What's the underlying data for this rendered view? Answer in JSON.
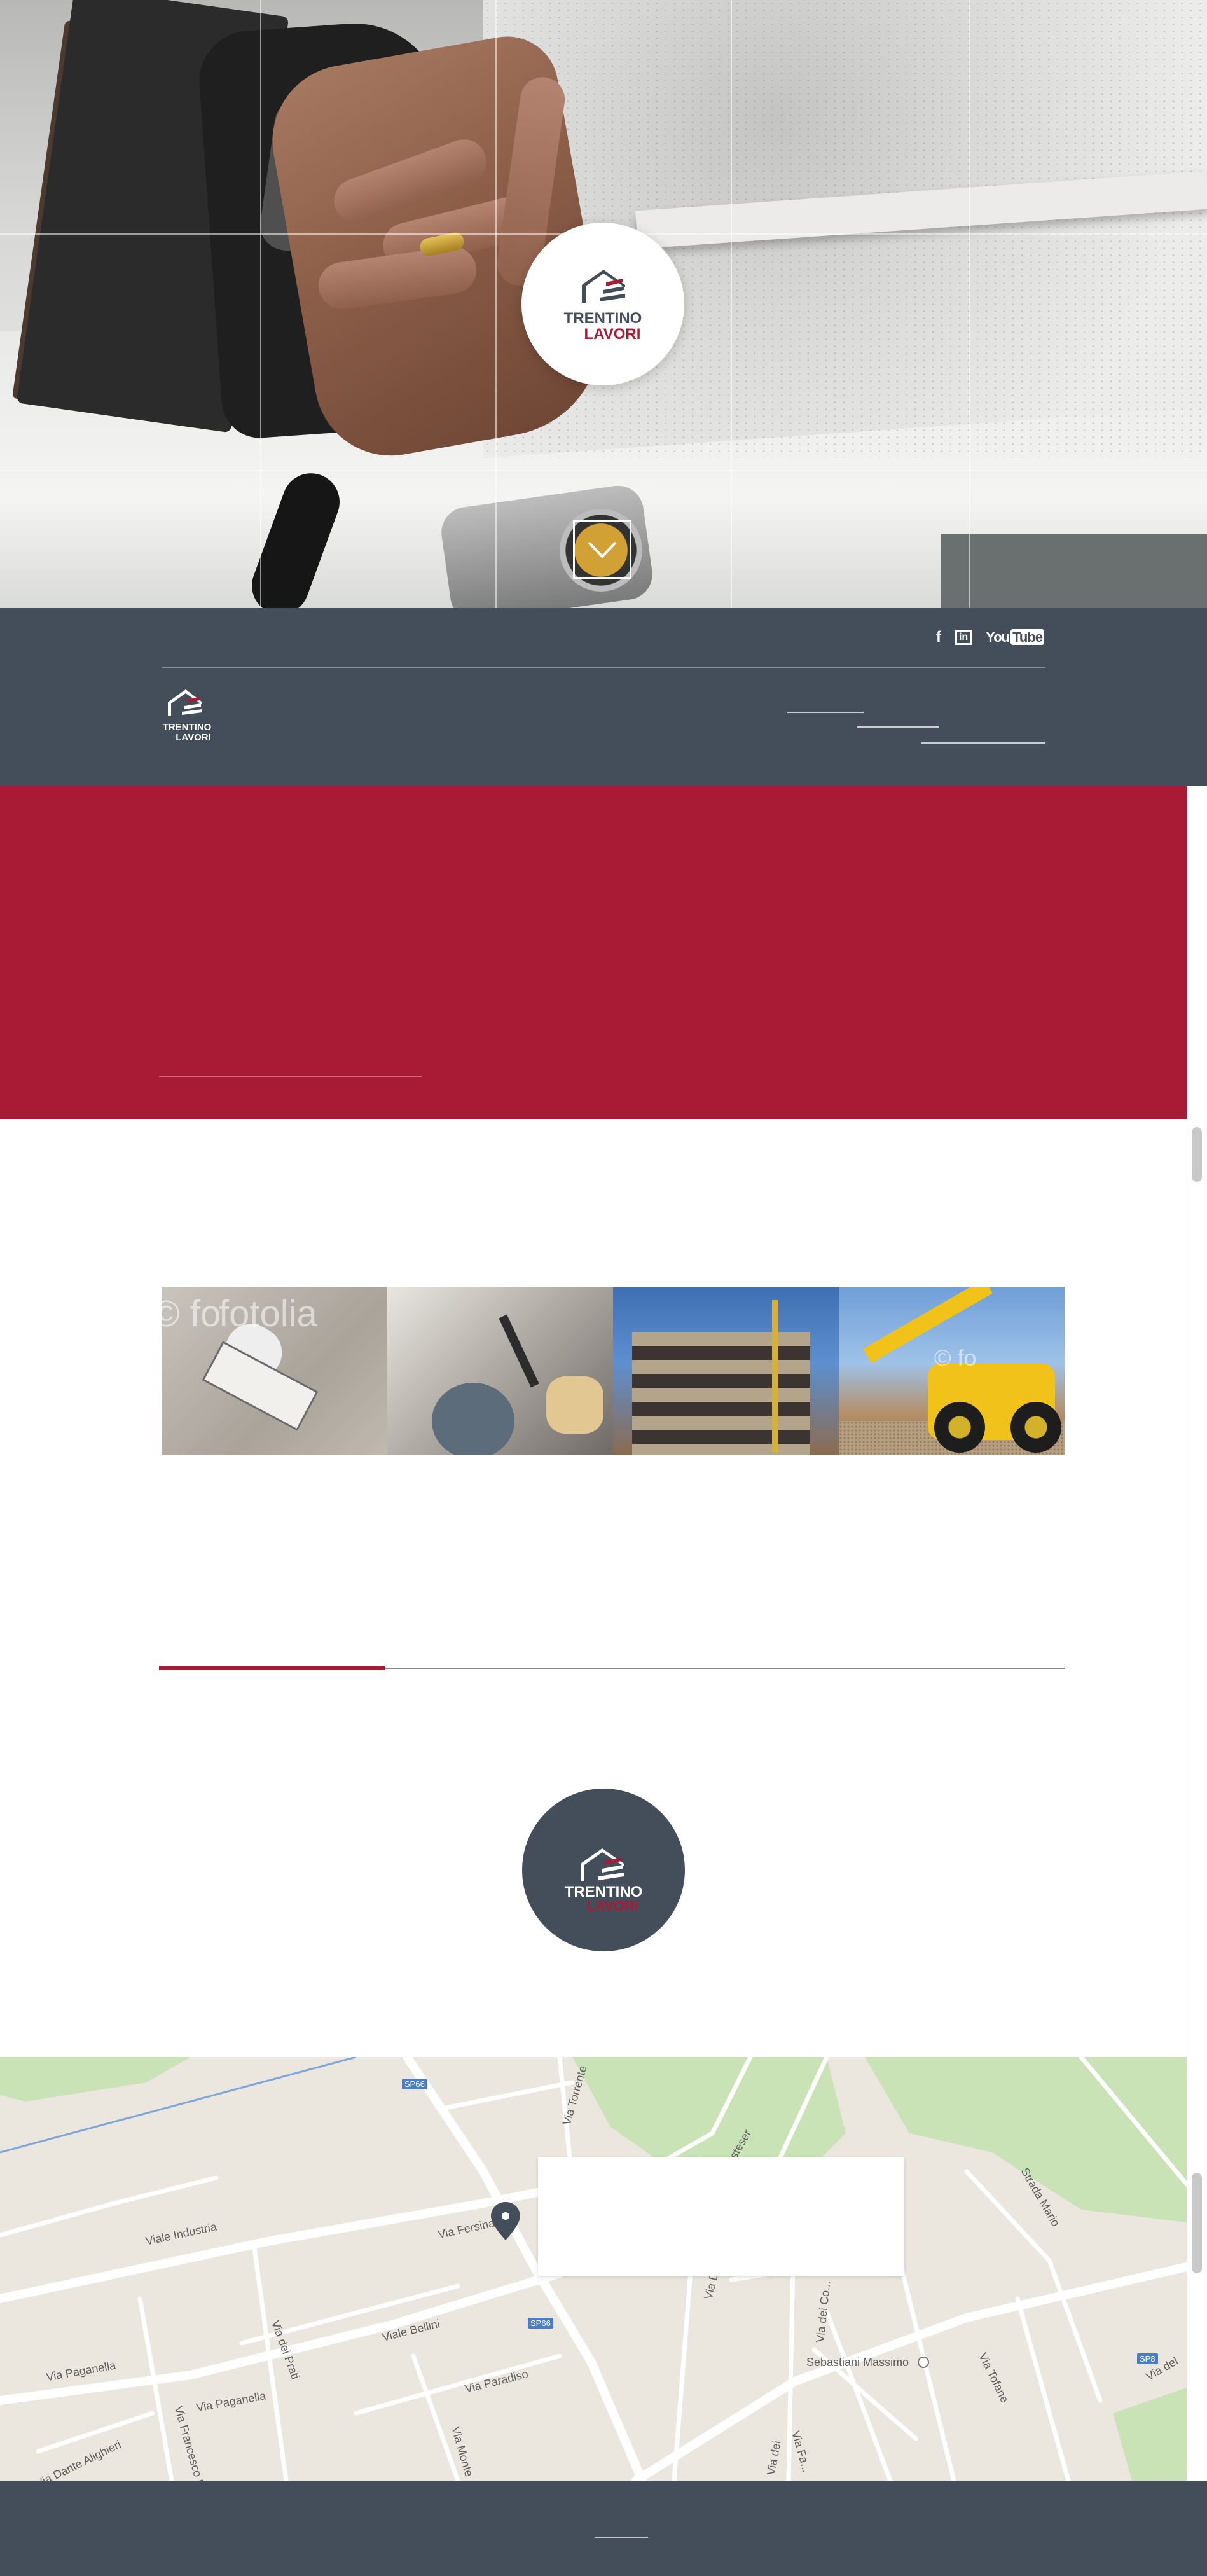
{
  "brand": {
    "name_line1": "TRENTINO",
    "name_line2": "LAVORI",
    "colors": {
      "accent": "#a91b34",
      "dark": "#444e5b"
    }
  },
  "header": {
    "social": [
      {
        "icon": "facebook-icon",
        "label": "f"
      },
      {
        "icon": "linkedin-icon",
        "label": "in"
      },
      {
        "icon": "youtube-icon",
        "label": "You",
        "label2": "Tube"
      }
    ]
  },
  "hero": {
    "scroll_icon": "chevron-down-icon"
  },
  "gallery": {
    "watermark": "fotolia",
    "watermark_short": "© fo"
  },
  "progress": {
    "value_fraction": 0.25
  },
  "map": {
    "roads": [
      "Viale Industria",
      "Via Fersina",
      "Viale Bellini",
      "Via Paganella",
      "Via Paganella",
      "Via dei Prati",
      "Via Paradiso",
      "Via Dante Alighieri",
      "Via Francesco D...",
      "Via Monte",
      "Via Torrente",
      "Strada Mario",
      "Via Tofane",
      "Via dei Co...",
      "Via Fa...",
      "Via Di...",
      "Sebastiani Massimo",
      "Via Costeser",
      "Via dei",
      "Via del"
    ],
    "shields": [
      "SP66",
      "SP66",
      "SP8"
    ]
  }
}
